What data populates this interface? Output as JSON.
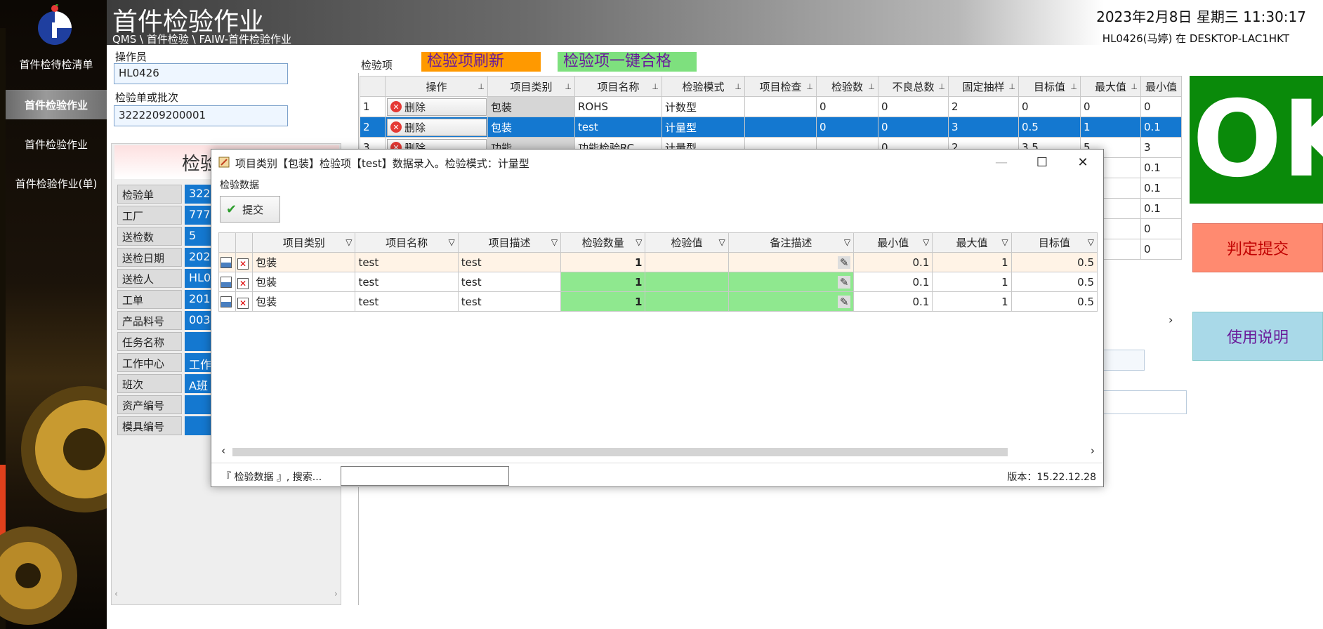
{
  "app": {
    "title": "首件检验作业",
    "breadcrumb": "QMS \\ 首件检验 \\ FAIW-首件检验作业",
    "datetime": "2023年2月8日 星期三 11:30:17",
    "userinfo": "HL0426(马婷) 在 DESKTOP-LAC1HKT"
  },
  "sidebar": {
    "items": [
      {
        "label": "首件检待检清单"
      },
      {
        "label": "首件检验作业"
      },
      {
        "label": "首件检验作业"
      },
      {
        "label": "首件检验作业(单)"
      }
    ]
  },
  "form": {
    "operator_label": "操作员",
    "operator_value": "HL0426",
    "batch_label": "检验单或批次",
    "batch_value": "3222209200001",
    "panel_head": "检验",
    "rows": [
      {
        "label": "检验单",
        "value": "322"
      },
      {
        "label": "工厂",
        "value": "777"
      },
      {
        "label": "送检数",
        "value": "5"
      },
      {
        "label": "送检日期",
        "value": "202"
      },
      {
        "label": "送检人",
        "value": "HL0"
      },
      {
        "label": "工单",
        "value": "201"
      },
      {
        "label": "产品料号",
        "value": "003"
      },
      {
        "label": "任务名称",
        "value": ""
      },
      {
        "label": "工作中心",
        "value": "工作"
      },
      {
        "label": "班次",
        "value": "A班"
      },
      {
        "label": "资产编号",
        "value": ""
      },
      {
        "label": "模具编号",
        "value": ""
      }
    ]
  },
  "main": {
    "items_label": "检验项",
    "refresh_btn": "检验项刷新",
    "pass_btn": "检验项一键合格",
    "columns": [
      "操作",
      "项目类别",
      "项目名称",
      "检验模式",
      "项目检查",
      "检验数",
      "不良总数",
      "固定抽样",
      "目标值",
      "最大值",
      "最小值"
    ],
    "delete_label": "删除",
    "rows": [
      {
        "no": "1",
        "category": "包装",
        "name": "ROHS",
        "mode": "计数型",
        "check": "",
        "count": "0",
        "bad": "0",
        "fixed": "2",
        "target": "0",
        "max": "0",
        "min": "0"
      },
      {
        "no": "2",
        "category": "包装",
        "name": "test",
        "mode": "计量型",
        "check": "",
        "count": "0",
        "bad": "0",
        "fixed": "3",
        "target": "0.5",
        "max": "1",
        "min": "0.1"
      },
      {
        "no": "3",
        "category": "功能",
        "name": "功能检验RC",
        "mode": "计量型",
        "check": "",
        "count": "",
        "bad": "0",
        "fixed": "2",
        "target": "3.5",
        "max": "5",
        "min": "3"
      },
      {
        "no": "",
        "category": "",
        "name": "",
        "mode": "",
        "check": "",
        "count": "",
        "bad": "",
        "fixed": "",
        "target": "",
        "max": "",
        "min": "0.1"
      },
      {
        "no": "",
        "category": "",
        "name": "",
        "mode": "",
        "check": "",
        "count": "",
        "bad": "",
        "fixed": "",
        "target": "",
        "max": "",
        "min": "0.1"
      },
      {
        "no": "",
        "category": "",
        "name": "",
        "mode": "",
        "check": "",
        "count": "",
        "bad": "",
        "fixed": "",
        "target": "",
        "max": "",
        "min": "0.1"
      },
      {
        "no": "",
        "category": "",
        "name": "",
        "mode": "",
        "check": "",
        "count": "",
        "bad": "",
        "fixed": "",
        "target": "",
        "max": "",
        "min": "0"
      },
      {
        "no": "",
        "category": "",
        "name": "",
        "mode": "",
        "check": "",
        "count": "",
        "bad": "",
        "fixed": "",
        "target": "",
        "max": "",
        "min": "0"
      }
    ],
    "selected_row": 1,
    "scroll_arrow": "›"
  },
  "right": {
    "ok_text": "OK",
    "judge_btn": "判定提交",
    "help_btn": "使用说明",
    "ok_color": "#0a8a0a"
  },
  "dialog": {
    "title": "项目类别【包装】检验项【test】数据录入。检验模式：计量型",
    "section_label": "检验数据",
    "submit_btn": "提交",
    "columns": [
      "项目类别",
      "项目名称",
      "项目描述",
      "检验数量",
      "检验值",
      "备注描述",
      "最小值",
      "最大值",
      "目标值"
    ],
    "rows": [
      {
        "category": "包装",
        "name": "test",
        "desc": "test",
        "qty": "1",
        "value": "",
        "remark": "",
        "min": "0.1",
        "max": "1",
        "target": "0.5"
      },
      {
        "category": "包装",
        "name": "test",
        "desc": "test",
        "qty": "1",
        "value": "",
        "remark": "",
        "min": "0.1",
        "max": "1",
        "target": "0.5"
      },
      {
        "category": "包装",
        "name": "test",
        "desc": "test",
        "qty": "1",
        "value": "",
        "remark": "",
        "min": "0.1",
        "max": "1",
        "target": "0.5"
      }
    ],
    "search_text": "『 检验数据 』, 搜索...",
    "search_value": "",
    "version": "版本：15.22.12.28",
    "minimize": "—",
    "maximize": "☐",
    "close": "✕"
  }
}
